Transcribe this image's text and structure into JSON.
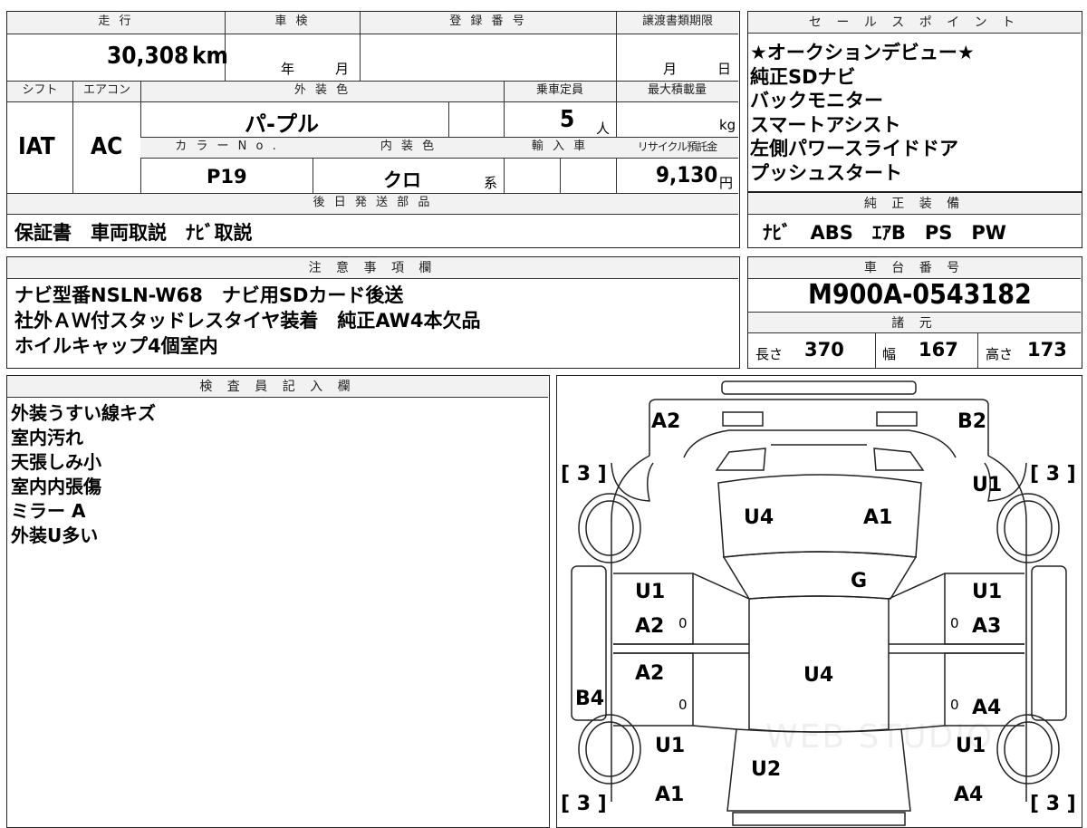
{
  "vehicle": {
    "mileage_header": "走 行",
    "mileage": "30,308",
    "mileage_unit": "km",
    "inspection_header": "車 検",
    "inspection_year_label": "年",
    "inspection_month_label": "月",
    "registration_header": "登 録 番 号",
    "transfer_header": "譲渡書類期限",
    "transfer_month_label": "月",
    "transfer_day_label": "日",
    "shift_header": "シフト",
    "shift": "IAT",
    "ac_header": "エアコン",
    "ac": "AC",
    "exterior_header": "外 装 色",
    "exterior_color": "パ-プル",
    "capacity_header": "乗車定員",
    "capacity": "5",
    "capacity_unit": "人",
    "max_load_header": "最大積載量",
    "max_load_unit": "kg",
    "color_no_header": "カ ラ ー N o .",
    "color_no": "P19",
    "interior_header": "内 装 色",
    "interior_color": "クロ",
    "interior_suffix": "系",
    "import_header": "輸 入 車",
    "recycle_header": "リサイクル預託金",
    "recycle_fee": "9,130",
    "recycle_unit": "円"
  },
  "sales_points": {
    "header": "セ ー ル ス ポ イ ン ト",
    "items": [
      "★オークションデビュー★",
      "純正SDナビ",
      "バックモニター",
      "スマートアシスト",
      "左側パワースライドドア",
      "プッシュスタート"
    ]
  },
  "later_parts": {
    "header": "後 日 発 送 部 品",
    "text": "保証書　車両取説　ﾅﾋﾞ取説"
  },
  "genuine_equipment": {
    "header": "純 正 装 備",
    "text": "ﾅﾋﾞ　ABS　ｴｱB　PS　PW"
  },
  "notes": {
    "header": "注 意 事 項 欄",
    "lines": [
      "ナビ型番NSLN-W68　ナビ用SDカード後送",
      "社外ＡＷ付スタッドレスタイヤ装着　純正AW4本欠品",
      "ホイルキャップ4個室内"
    ]
  },
  "chassis": {
    "header": "車 台 番 号",
    "number": "M900A-0543182",
    "spec_header": "諸 元",
    "length_label": "長さ",
    "length": "370",
    "width_label": "幅",
    "width": "167",
    "height_label": "高さ",
    "height": "173"
  },
  "inspector": {
    "header": "検 査 員 記 入 欄",
    "lines": [
      "外装うすい線キズ",
      "室内汚れ",
      "天張しみ小",
      "室内内張傷",
      "ミラー A",
      "外装U多い"
    ]
  },
  "diagram": {
    "tire_left_top": "[ 3 ]",
    "tire_right_top": "[ 3 ]",
    "tire_left_bottom": "[ 3 ]",
    "tire_right_bottom": "[ 3 ]",
    "front_left": "A2",
    "front_right": "B2",
    "fender_right_front": "U1",
    "hood_left": "U4",
    "hood_right": "A1",
    "windshield": "G",
    "door_fl_1": "U1",
    "door_fl_2": "A2",
    "door_fr_1": "U1",
    "door_fr_2": "A3",
    "door_rl": "A2",
    "roof": "U4",
    "sill_left": "B4",
    "door_rr": "A4",
    "rear_fender_left": "U1",
    "rear_fender_right": "U1",
    "rear_center": "U2",
    "rear_left": "A1",
    "rear_right": "A4",
    "zero": "0",
    "watermark": "WEB STUDIO"
  }
}
